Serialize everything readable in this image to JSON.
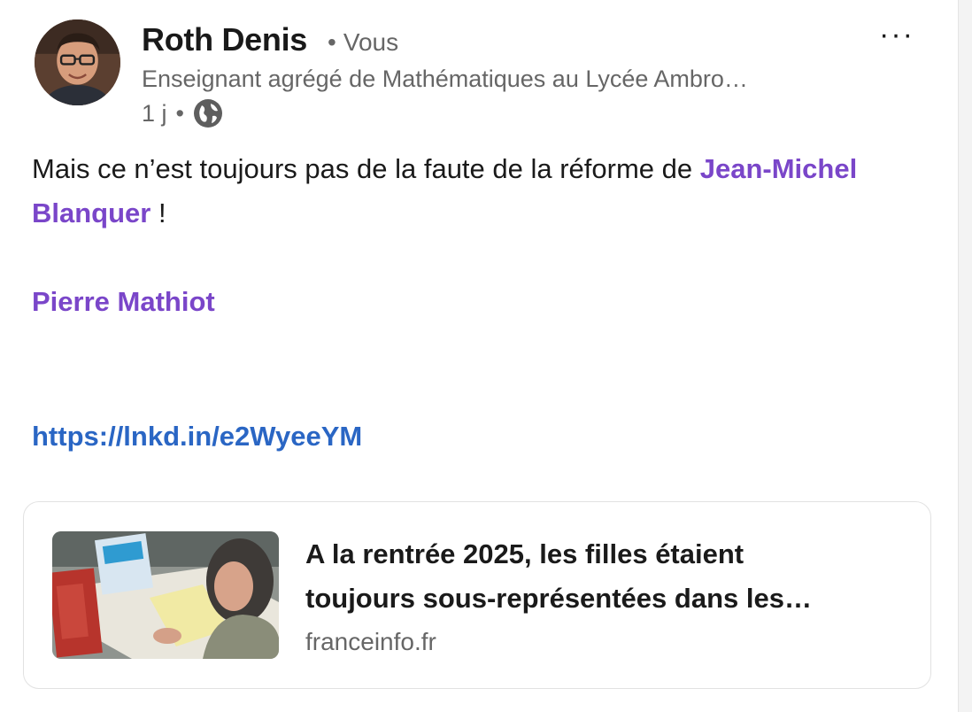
{
  "author": {
    "name": "Roth Denis",
    "relation": "Vous",
    "headline": "Enseignant agrégé de Mathématiques au Lycée Ambro…",
    "time": "1 j",
    "visibility_icon": "globe-icon"
  },
  "menu": {
    "more_label": "···"
  },
  "post": {
    "text_before": "Mais ce n’est toujours pas de la faute de la réforme de ",
    "mention_1": "Jean-Michel Blanquer",
    "text_after": " !",
    "mention_2": "Pierre Mathiot",
    "link": "https://lnkd.in/e2WyeeYM"
  },
  "link_card": {
    "title_line_1": "A la rentrée 2025, les filles étaient",
    "title_line_2": "toujours sous-représentées dans les…",
    "source": "franceinfo.fr"
  },
  "colors": {
    "mention": "#7a46c9",
    "link": "#2a66c4",
    "secondary_text": "#666666"
  }
}
